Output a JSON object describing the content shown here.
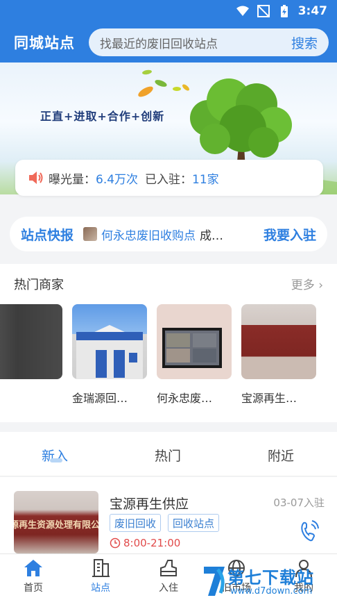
{
  "status_bar": {
    "time": "3:47"
  },
  "top_bar": {
    "city": "同城站点",
    "search_placeholder": "找最近的废旧回收站点",
    "search_button": "搜索"
  },
  "banner": {
    "slogan": "正直+进取+合作+创新"
  },
  "stats": {
    "exposure_label": "曝光量：",
    "exposure_value": "6.4万次",
    "joined_label": "已入驻：",
    "joined_value": "11家"
  },
  "news": {
    "title": "站点快报",
    "text": "何永忠废旧收购点",
    "suffix": "成…",
    "join_button": "我要入驻"
  },
  "hot": {
    "title": "热门商家",
    "more": "更多",
    "merchants": [
      {
        "name": ""
      },
      {
        "name": "金瑞源回…"
      },
      {
        "name": "何永忠废…"
      },
      {
        "name": "宝源再生…"
      }
    ]
  },
  "tabs": {
    "items": [
      "新入",
      "热门",
      "附近"
    ],
    "active": 0
  },
  "list": [
    {
      "title": "宝源再生供应",
      "date": "03-07入驻",
      "tags": [
        "废旧回收",
        "回收站点"
      ],
      "hours": "8:00-21:00",
      "sign_text": "源再生资源处理有限公"
    }
  ],
  "bottom_nav": {
    "items": [
      "首页",
      "站点",
      "入住",
      "旧市场",
      "我的"
    ],
    "active": 1
  },
  "watermark": {
    "text": "第七下载站",
    "url": "www.d7down.com"
  },
  "colors": {
    "primary": "#2e7fe0",
    "hours_red": "#e14a4a"
  }
}
